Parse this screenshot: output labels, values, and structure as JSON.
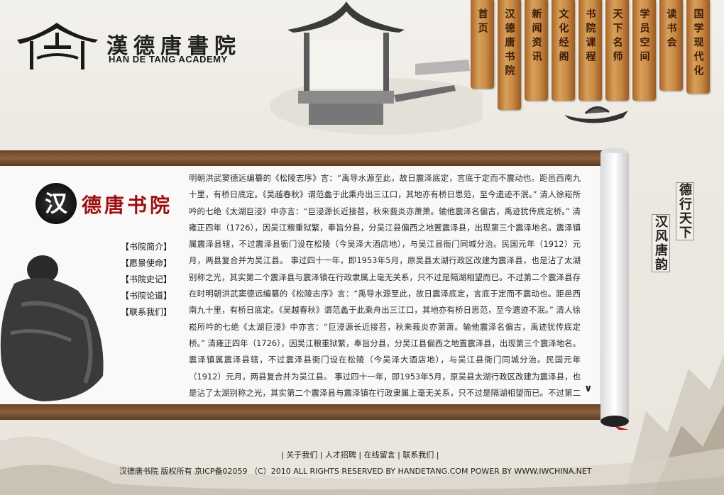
{
  "header": {
    "logo_cn": "漢德唐書院",
    "logo_en": "HAN DE TANG ACADEMY"
  },
  "nav": [
    {
      "label": "首页"
    },
    {
      "label": "汉德唐书院"
    },
    {
      "label": "新闻资讯"
    },
    {
      "label": "文化经阁"
    },
    {
      "label": "书院课程"
    },
    {
      "label": "天下名师"
    },
    {
      "label": "学员空间"
    },
    {
      "label": "读书会"
    },
    {
      "label": "国学现代化"
    }
  ],
  "brand": {
    "han_char": "汉",
    "title": "德唐书院"
  },
  "side_menu": [
    {
      "label": "【书院简介】"
    },
    {
      "label": "【愿景使命】"
    },
    {
      "label": "【书院史记】"
    },
    {
      "label": "【书院论道】"
    },
    {
      "label": "【联系我们】"
    }
  ],
  "article": {
    "text": "明朝洪武窦德远编纂的《松陵志序》言：“禹导水源至此，故日震泽底定，言底于定而不震动也。距邑西南九十里，有桥日底定。《吴越春秋》谓范蠡于此乘舟出三江口，其地亦有桥日思范，至今遗迹不泯。” 清人徐崧所吟的七绝《太湖巨浸》中亦言：“巨浸源长近接苕，秋来莪炎亦萧萧。输他震泽名偏古，禹迹犹传底定桥。” 清雍正四年（1726），因吴江粮重狱繁，奉旨分县，分吴江县偏西之地置震泽县，出现第三个震泽地名。震泽镇属震泽县辖，不过震泽县衙门设在松陵（今吴泽大酒店地），与吴江县衙门同城分治。民国元年（1912）元月，两县复合并为吴江县。 事过四十一年，即1953年5月，原吴县太湖行政区改建为震泽县，也是沾了太湖别称之光，其实第二个震泽县与震泽镇在行政隶属上毫无关系，只不过是隔湖相望而已。不过第二个震泽县存在时明朝洪武窦德远编纂的《松陵志序》言：“禹导水源至此，故日震泽底定，言底于定而不震动也。距邑西南九十里，有桥日底定。《吴越春秋》谓范蠡于此乘舟出三江口，其地亦有桥日思范，至今遗迹不泯。” 清人徐崧所吟的七绝《太湖巨浸》中亦言：“巨浸源长近接苕，秋来莪炎亦萧萧。输他震泽名偏古，禹迹犹传底定桥。” 清雍正四年（1726），因吴江粮重狱繁，奉旨分县，分吴江县偏西之地置震泽县，出现第三个震泽地名。震泽镇属震泽县辖，不过震泽县衙门设在松陵（今吴泽大酒店地），与吴江县衙门同城分治。民国元年（1912）元月，两县复合并为吴江县。 事过四十一年，即1953年5月，原吴县太湖行政区改建为震泽县，也是沾了太湖别称之光，其实第二个震泽县与震泽镇在行政隶属上毫无关系，只不过是隔湖相望而已。不过第二个震泽县存在时"
  },
  "motto": {
    "line1": "德行天下",
    "line2": "汉风唐韵"
  },
  "scroll_down_icon": "chevron-down-icon",
  "footer": {
    "links": [
      "关于我们",
      "人才招聘",
      "在线留言",
      "联系我们"
    ],
    "copyright": "汉德唐书院 版权所有 京ICP备02059 （C）2010 ALL RIGHTS RESERVED BY HANDETANG.COM POWER BY WWW.IWCHINA.NET"
  }
}
